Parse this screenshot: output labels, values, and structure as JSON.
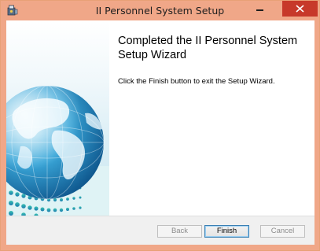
{
  "window": {
    "title": "II Personnel System Setup",
    "app_icon": "installer-icon"
  },
  "titlebar_buttons": {
    "minimize_icon": "minimize-icon",
    "close_icon": "close-icon"
  },
  "banner": {
    "image": "globe-illustration"
  },
  "content": {
    "heading": "Completed the II Personnel System Setup Wizard",
    "message": "Click the Finish button to exit the Setup Wizard."
  },
  "footer": {
    "back_label": "Back",
    "finish_label": "Finish",
    "cancel_label": "Cancel"
  },
  "colors": {
    "titlebar": "#f0a788",
    "close_button": "#c7392a",
    "footer": "#f0f0f0"
  }
}
